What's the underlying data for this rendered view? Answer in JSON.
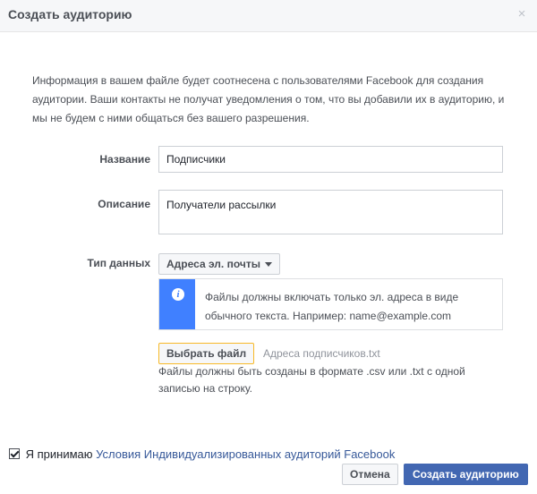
{
  "dialog": {
    "title": "Создать аудиторию",
    "close_icon": "×"
  },
  "intro": "Информация в вашем файле будет соотнесена с пользователями Facebook для создания аудитории. Ваши контакты не получат уведомления о том, что вы добавили их в аудиторию, и мы не будем с ними общаться без вашего разрешения.",
  "form": {
    "name_label": "Название",
    "name_value": "Подписчики",
    "description_label": "Описание",
    "description_value": "Получатели рассылки",
    "data_type_label": "Тип данных",
    "data_type_selected": "Адреса эл. почты",
    "notice_text": "Файлы должны включать только эл. адреса в виде обычного текста. Например: name@example.com",
    "choose_file_label": "Выбрать файл",
    "file_name": "Адреса подписчиков.txt",
    "file_hint": "Файлы должны быть созданы в формате .csv или .txt с одной записью на строку."
  },
  "footer": {
    "agree_text": "Я принимаю",
    "agree_link": "Условия Индивидуализированных аудиторий Facebook",
    "agree_checked": true,
    "cancel_label": "Отмена",
    "create_label": "Создать аудиторию"
  },
  "colors": {
    "header_bg": "#f6f7f9",
    "primary_button": "#4267b2",
    "link": "#365899",
    "info_accent": "#4080ff",
    "file_button_border": "#f7b928"
  }
}
